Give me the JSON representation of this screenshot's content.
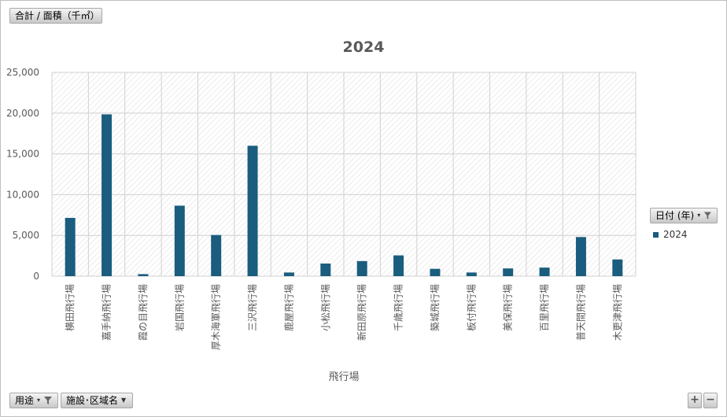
{
  "chart_data": {
    "type": "bar",
    "title": "2024",
    "xlabel": "飛行場",
    "ylabel": "",
    "ylim": [
      0,
      25000
    ],
    "yticks": [
      "0",
      "5,000",
      "10,000",
      "15,000",
      "20,000",
      "25,000"
    ],
    "categories": [
      "横田飛行場",
      "嘉手納飛行場",
      "霞の目飛行場",
      "岩国飛行場",
      "厚木海軍飛行場",
      "三沢飛行場",
      "鹿屋飛行場",
      "小松飛行場",
      "新田原飛行場",
      "千歳飛行場",
      "築城飛行場",
      "板付飛行場",
      "美保飛行場",
      "百里飛行場",
      "普天間飛行場",
      "木更津飛行場"
    ],
    "series": [
      {
        "name": "2024",
        "values": [
          7150,
          19850,
          250,
          8650,
          5050,
          16000,
          450,
          1550,
          1850,
          2550,
          900,
          450,
          950,
          1050,
          4800,
          2050
        ]
      }
    ],
    "grid": true,
    "legend": "right",
    "bar_color": "#1a5d7e"
  },
  "controls": {
    "measure_label": "合計 / 面積（千㎡）",
    "legend_field_label": "日付 (年)",
    "usage_label": "用途",
    "facility_label": "施設･区域名",
    "zoom_in": "+",
    "zoom_out": "−"
  },
  "icons": {
    "filter": "filter-icon",
    "dropdown": "chevron-down-icon"
  }
}
